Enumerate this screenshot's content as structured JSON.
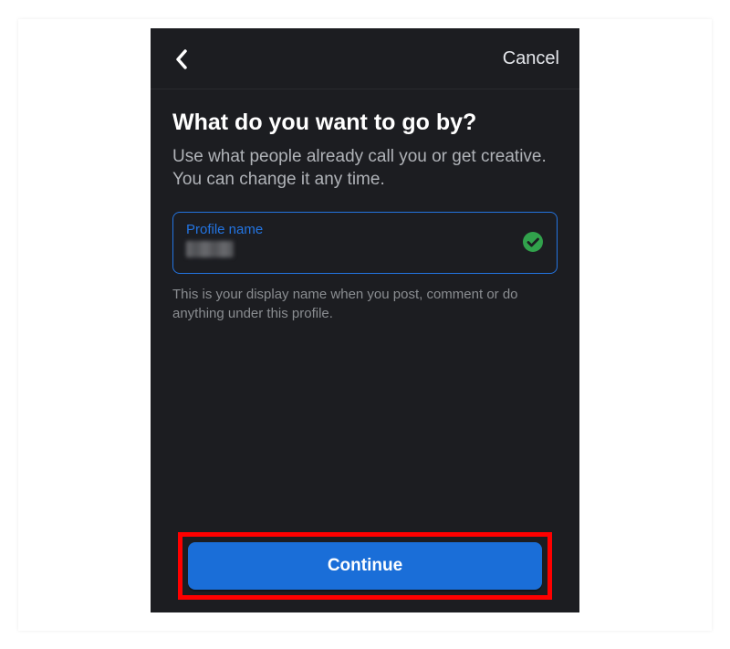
{
  "header": {
    "cancel_label": "Cancel"
  },
  "main": {
    "title": "What do you want to go by?",
    "subtitle": "Use what people already call you or get creative. You can change it any time.",
    "field_label": "Profile name",
    "helper_text": "This is your display name when you post, comment or do anything under this profile."
  },
  "footer": {
    "continue_label": "Continue"
  },
  "colors": {
    "accent": "#2374e1",
    "success": "#31a24c",
    "highlight": "#ff0000"
  }
}
